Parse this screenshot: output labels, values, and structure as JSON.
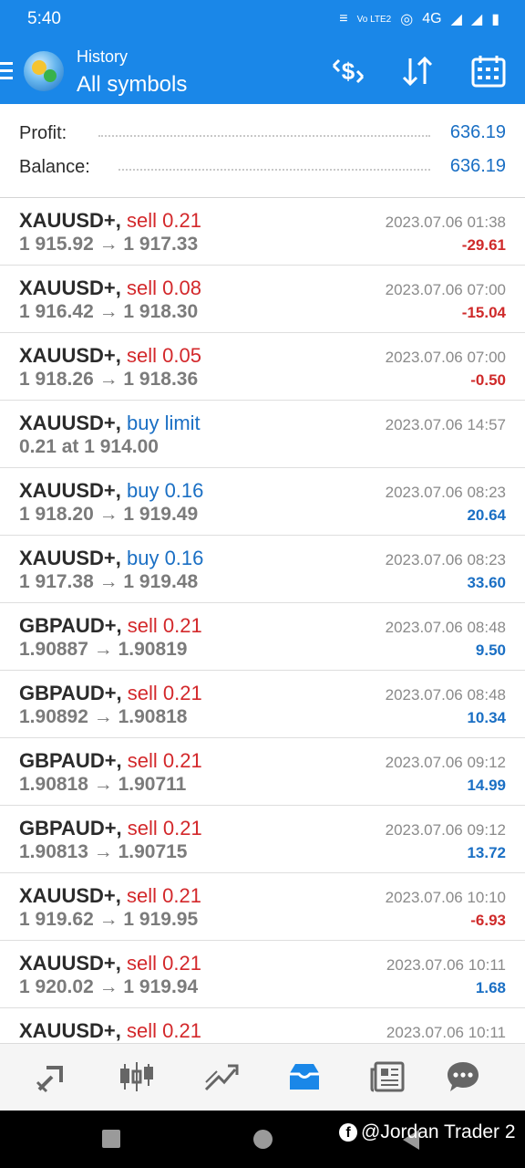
{
  "status_bar": {
    "time": "5:40",
    "indicators": "Vo LTE2",
    "network": "4G"
  },
  "header": {
    "subtitle": "History",
    "title": "All symbols",
    "icons": [
      "deposit-withdraw-icon",
      "sort-icon",
      "calendar-icon"
    ]
  },
  "summary": {
    "profit_label": "Profit:",
    "profit_value": "636.19",
    "balance_label": "Balance:",
    "balance_value": "636.19"
  },
  "trades": [
    {
      "symbol": "XAUUSD+,",
      "action": "sell 0.21",
      "side": "sell",
      "prices": "1 915.92 → 1 917.33",
      "time": "2023.07.06 01:38",
      "profit": "-29.61",
      "sign": "neg"
    },
    {
      "symbol": "XAUUSD+,",
      "action": "sell 0.08",
      "side": "sell",
      "prices": "1 916.42 → 1 918.30",
      "time": "2023.07.06 07:00",
      "profit": "-15.04",
      "sign": "neg"
    },
    {
      "symbol": "XAUUSD+,",
      "action": "sell 0.05",
      "side": "sell",
      "prices": "1 918.26 → 1 918.36",
      "time": "2023.07.06 07:00",
      "profit": "-0.50",
      "sign": "neg"
    },
    {
      "symbol": "XAUUSD+,",
      "action": "buy limit",
      "side": "buy",
      "prices": "0.21 at 1 914.00",
      "time": "2023.07.06 14:57",
      "profit": "",
      "sign": "pos"
    },
    {
      "symbol": "XAUUSD+,",
      "action": "buy 0.16",
      "side": "buy",
      "prices": "1 918.20 → 1 919.49",
      "time": "2023.07.06 08:23",
      "profit": "20.64",
      "sign": "pos"
    },
    {
      "symbol": "XAUUSD+,",
      "action": "buy 0.16",
      "side": "buy",
      "prices": "1 917.38 → 1 919.48",
      "time": "2023.07.06 08:23",
      "profit": "33.60",
      "sign": "pos"
    },
    {
      "symbol": "GBPAUD+,",
      "action": "sell 0.21",
      "side": "sell",
      "prices": "1.90887 → 1.90819",
      "time": "2023.07.06 08:48",
      "profit": "9.50",
      "sign": "pos"
    },
    {
      "symbol": "GBPAUD+,",
      "action": "sell 0.21",
      "side": "sell",
      "prices": "1.90892 → 1.90818",
      "time": "2023.07.06 08:48",
      "profit": "10.34",
      "sign": "pos"
    },
    {
      "symbol": "GBPAUD+,",
      "action": "sell 0.21",
      "side": "sell",
      "prices": "1.90818 → 1.90711",
      "time": "2023.07.06 09:12",
      "profit": "14.99",
      "sign": "pos"
    },
    {
      "symbol": "GBPAUD+,",
      "action": "sell 0.21",
      "side": "sell",
      "prices": "1.90813 → 1.90715",
      "time": "2023.07.06 09:12",
      "profit": "13.72",
      "sign": "pos"
    },
    {
      "symbol": "XAUUSD+,",
      "action": "sell 0.21",
      "side": "sell",
      "prices": "1 919.62 → 1 919.95",
      "time": "2023.07.06 10:10",
      "profit": "-6.93",
      "sign": "neg"
    },
    {
      "symbol": "XAUUSD+,",
      "action": "sell 0.21",
      "side": "sell",
      "prices": "1 920.02 → 1 919.94",
      "time": "2023.07.06 10:11",
      "profit": "1.68",
      "sign": "pos"
    },
    {
      "symbol": "XAUUSD+,",
      "action": "sell 0.21",
      "side": "sell",
      "prices": "",
      "time": "2023.07.06 10:11",
      "profit": "",
      "sign": "pos"
    }
  ],
  "bottom_nav": {
    "icons": [
      "quotes-icon",
      "chart-icon",
      "trade-icon",
      "history-icon",
      "news-icon",
      "messages-icon"
    ],
    "active": "history-icon"
  },
  "watermark": {
    "text": "@Jordan Trader 2"
  },
  "colors": {
    "header": "#1a87e8",
    "sell": "#d3282b",
    "buy": "#1a6fc4",
    "negative": "#cf2a2a",
    "positive": "#1a6fc4",
    "active_nav": "#1a87e8"
  }
}
